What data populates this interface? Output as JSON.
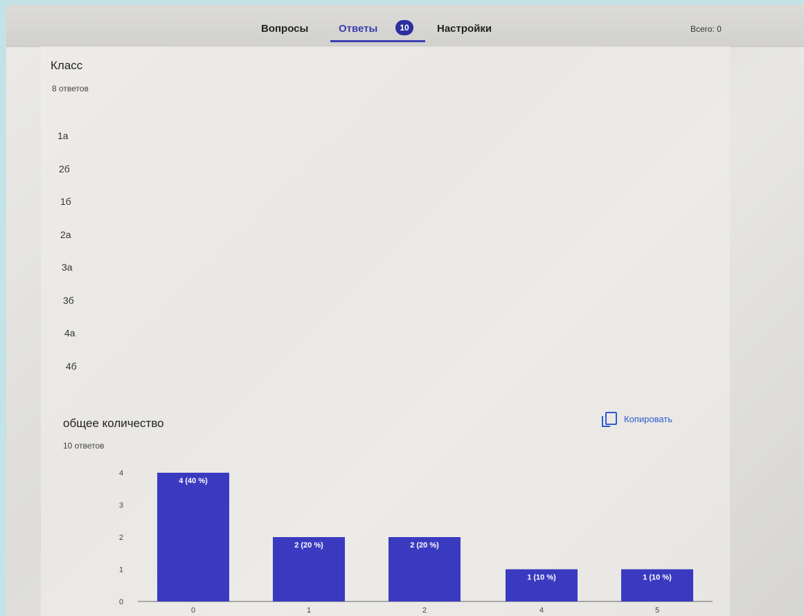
{
  "tabs": {
    "questions": "Вопросы",
    "answers": "Ответы",
    "answers_badge": "10",
    "settings": "Настройки"
  },
  "total": "Всего: 0",
  "question1": {
    "title": "Класс",
    "count": "8 ответов",
    "answers": [
      "1а",
      "2б",
      "1б",
      "2а",
      "3а",
      "3б",
      "4а",
      "4б"
    ]
  },
  "question2": {
    "title": "общее количество",
    "count": "10 ответов",
    "copy_label": "Копировать"
  },
  "colors": {
    "accent": "#3b3fb0",
    "bar": "#3a3ac0"
  },
  "chart_data": {
    "type": "bar",
    "categories": [
      "0",
      "1",
      "2",
      "4",
      "5"
    ],
    "values": [
      4,
      2,
      2,
      1,
      1
    ],
    "data_labels": [
      "4 (40 %)",
      "2 (20 %)",
      "2 (20 %)",
      "1 (10 %)",
      "1 (10 %)"
    ],
    "yticks": [
      "0",
      "1",
      "2",
      "3",
      "4"
    ],
    "ylim": [
      0,
      4
    ]
  }
}
